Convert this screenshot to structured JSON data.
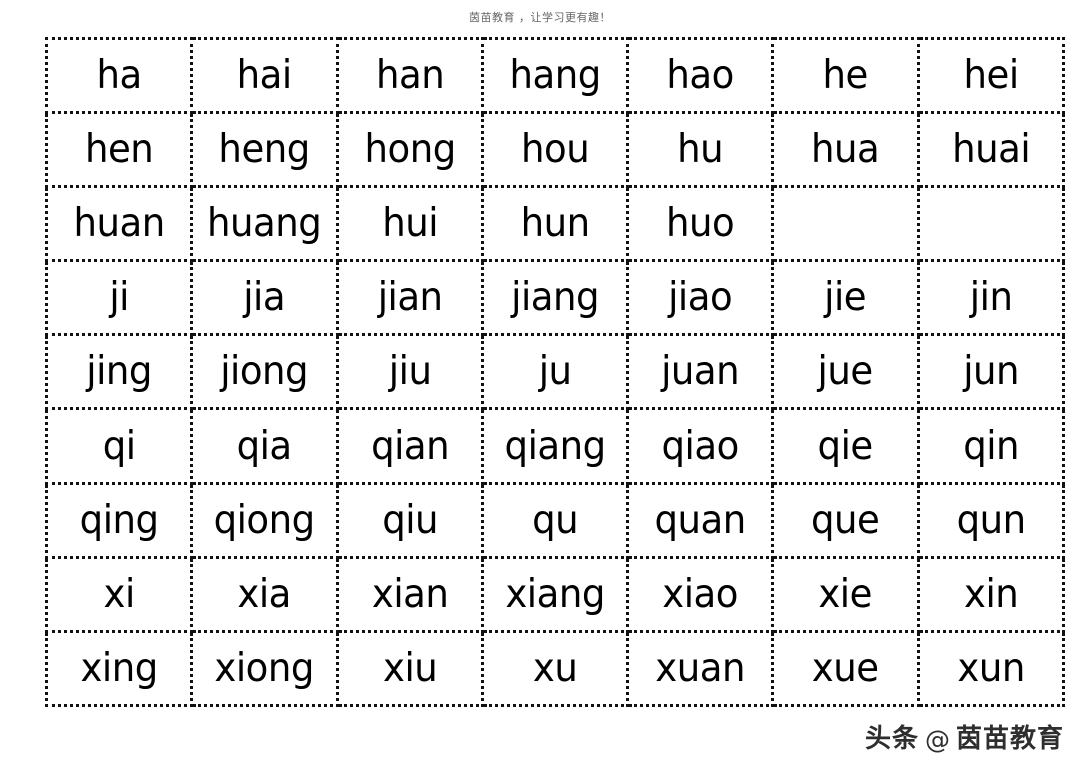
{
  "header": {
    "title": "茵苗教育 ，让学习更有趣！"
  },
  "watermark": {
    "brand": "头条",
    "at_symbol": "@",
    "account": "茵苗教育"
  },
  "table": {
    "columns": 7,
    "rows": 9,
    "border_style": "dotted",
    "border_color": "#111111",
    "text_color": "#000000",
    "background": "#ffffff",
    "cells": [
      [
        "ha",
        "hai",
        "han",
        "hang",
        "hao",
        "he",
        "hei"
      ],
      [
        "hen",
        "heng",
        "hong",
        "hou",
        "hu",
        "hua",
        "huai"
      ],
      [
        "huan",
        "huang",
        "hui",
        "hun",
        "huo",
        "",
        ""
      ],
      [
        "ji",
        "jia",
        "jian",
        "jiang",
        "jiao",
        "jie",
        "jin"
      ],
      [
        "jing",
        "jiong",
        "jiu",
        "ju",
        "juan",
        "jue",
        "jun"
      ],
      [
        "qi",
        "qia",
        "qian",
        "qiang",
        "qiao",
        "qie",
        "qin"
      ],
      [
        "qing",
        "qiong",
        "qiu",
        "qu",
        "quan",
        "que",
        "qun"
      ],
      [
        "xi",
        "xia",
        "xian",
        "xiang",
        "xiao",
        "xie",
        "xin"
      ],
      [
        "xing",
        "xiong",
        "xiu",
        "xu",
        "xuan",
        "xue",
        "xun"
      ]
    ]
  }
}
